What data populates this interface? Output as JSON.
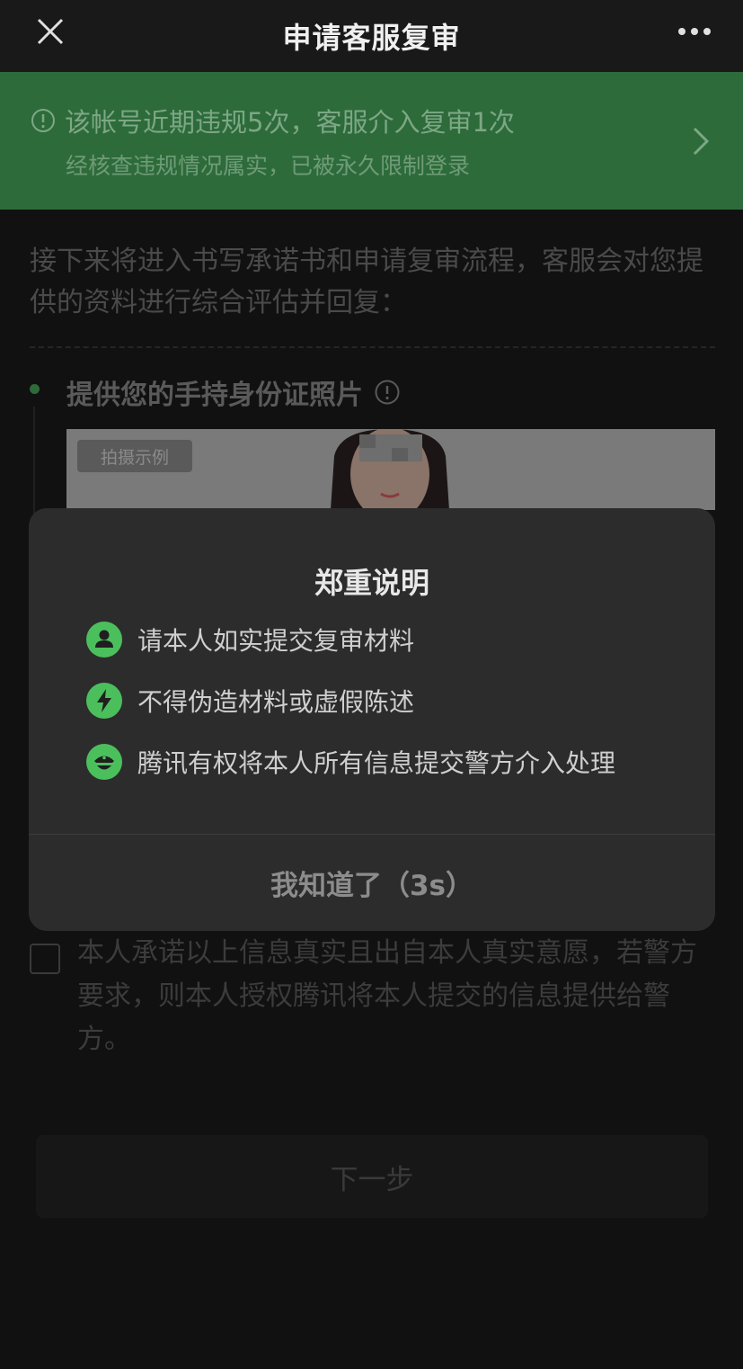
{
  "navbar": {
    "title": "申请客服复审",
    "close_icon": "close-icon",
    "more_icon": "more-icon"
  },
  "banner": {
    "line1": "该帐号近期违规5次，客服介入复审1次",
    "line2": "经核查违规情况属实，已被永久限制登录",
    "icon": "alert-circle-icon"
  },
  "intro": {
    "text": "接下来将进入书写承诺书和申请复审流程，客服会对您提供的资料进行综合评估并回复："
  },
  "step": {
    "title": "提供您的手持身份证照片",
    "sample_badge": "拍摄示例"
  },
  "commitment": {
    "text": "本人承诺以上信息真实且出自本人真实意愿，若警方要求，则本人授权腾讯将本人提交的信息提供给警方。"
  },
  "next_button": {
    "label": "下一步"
  },
  "modal": {
    "title": "郑重说明",
    "items": [
      {
        "icon": "person-icon",
        "text": "请本人如实提交复审材料"
      },
      {
        "icon": "lightning-icon",
        "text": "不得伪造材料或虚假陈述"
      },
      {
        "icon": "police-icon",
        "text": "腾讯有权将本人所有信息提交警方介入处理"
      }
    ],
    "confirm_label": "我知道了（3s）"
  },
  "colors": {
    "accent": "#4cbf5d",
    "banner_bg": "#2d6b3a",
    "modal_bg": "#2c2c2c"
  }
}
